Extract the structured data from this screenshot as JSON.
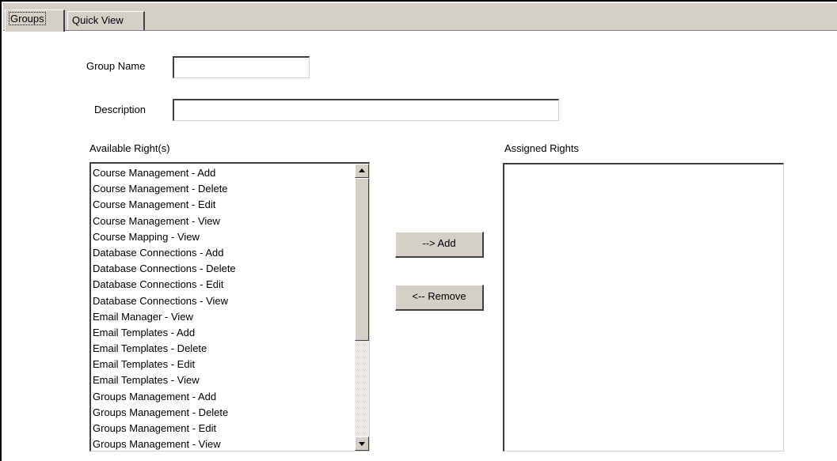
{
  "tabs": [
    {
      "label": "Groups",
      "active": true
    },
    {
      "label": "Quick View",
      "active": false
    }
  ],
  "form": {
    "group_name_label": "Group Name",
    "group_name_value": "",
    "description_label": "Description",
    "description_value": ""
  },
  "available": {
    "label": "Available Right(s)",
    "items": [
      "Course Management - Add",
      "Course Management - Delete",
      "Course Management - Edit",
      "Course Management - View",
      "Course Mapping - View",
      "Database Connections - Add",
      "Database Connections - Delete",
      "Database Connections - Edit",
      "Database Connections - View",
      "Email Manager - View",
      "Email Templates - Add",
      "Email Templates - Delete",
      "Email Templates - Edit",
      "Email Templates - View",
      "Groups Management - Add",
      "Groups Management - Delete",
      "Groups Management - Edit",
      "Groups Management - View"
    ]
  },
  "assigned": {
    "label": "Assigned Rights",
    "items": []
  },
  "buttons": {
    "add_label": "--> Add",
    "remove_label": "<-- Remove"
  },
  "icons": {
    "scroll_up": "up-arrow-icon",
    "scroll_down": "down-arrow-icon"
  },
  "colors": {
    "window_face": "#d4d0c8",
    "shadow": "#404040"
  }
}
